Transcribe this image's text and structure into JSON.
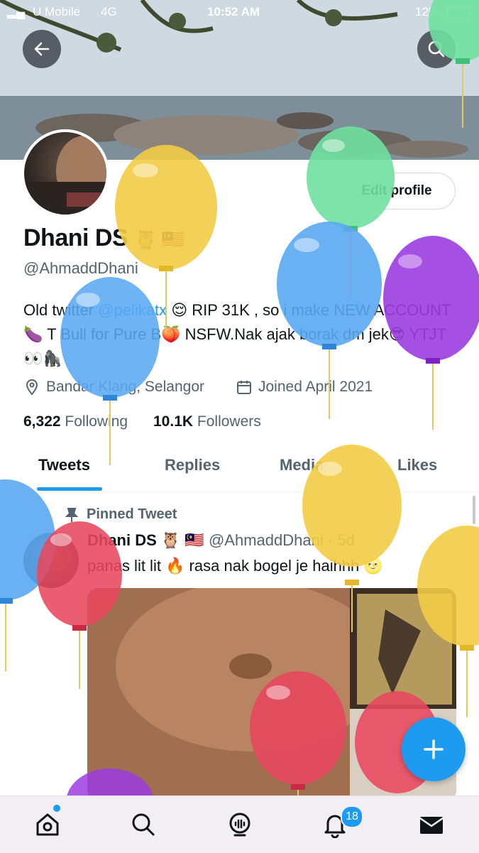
{
  "status_bar": {
    "carrier": "U Mobile",
    "network": "4G",
    "time": "10:52 AM",
    "battery": "12%"
  },
  "profile": {
    "name": "Dhani DS",
    "name_emoji": "🦉 🇲🇾",
    "handle": "@AhmaddDhani",
    "edit_label": "Edit profile",
    "bio": {
      "part1": "Old twitter ",
      "link": "@pelikatx",
      "part2": " 😌 RIP 31K , so i make NEW ACCOUNT 🍆 T Bull for Pure B🍑 NSFW.Nak ajak borak dm jek😎 YTJT 👀🦍"
    },
    "location": "Bandar Klang, Selangor",
    "joined": "Joined April 2021",
    "following_count": "6,322",
    "following_label": "Following",
    "followers_count": "10.1K",
    "followers_label": "Followers"
  },
  "tabs": [
    "Tweets",
    "Replies",
    "Media",
    "Likes"
  ],
  "pinned": {
    "label": "Pinned Tweet",
    "name": "Dhani DS",
    "name_emoji": "🦉 🇲🇾",
    "handle_time": "@AhmaddDhani · 5d",
    "text": "panas lit lit 🔥 rasa nak bogel je haihhh 🌝"
  },
  "notifications_badge": "18",
  "colors": {
    "accent": "#1d9bf0",
    "text": "#0f1419",
    "muted": "#536471"
  },
  "icons": [
    "back-arrow-icon",
    "search-icon",
    "location-pin-icon",
    "calendar-icon",
    "pin-icon",
    "plus-icon",
    "home-icon",
    "spaces-icon",
    "bell-icon",
    "mail-icon"
  ]
}
